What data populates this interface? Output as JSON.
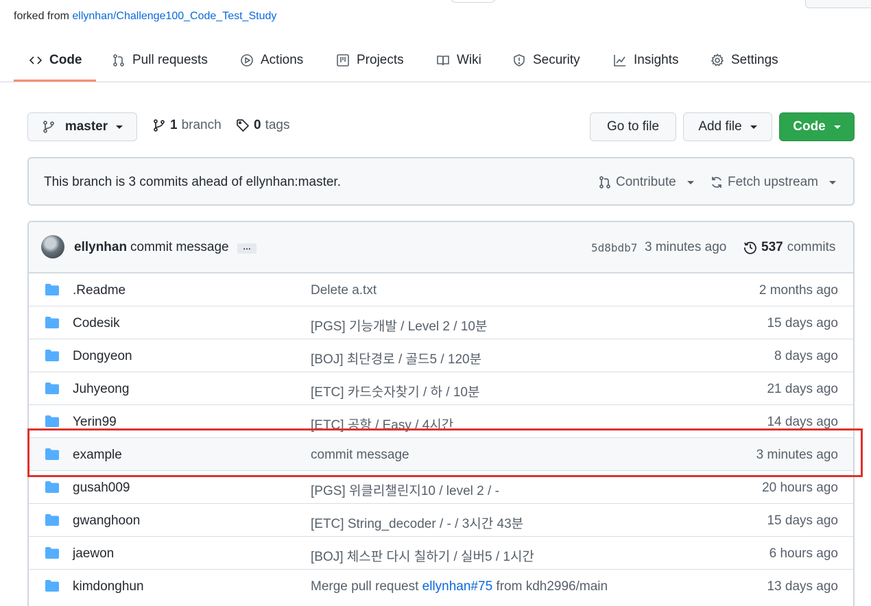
{
  "forked": {
    "prefix": "forked from ",
    "link": "ellynhan/Challenge100_Code_Test_Study"
  },
  "tabs": [
    {
      "label": "Code"
    },
    {
      "label": "Pull requests"
    },
    {
      "label": "Actions"
    },
    {
      "label": "Projects"
    },
    {
      "label": "Wiki"
    },
    {
      "label": "Security"
    },
    {
      "label": "Insights"
    },
    {
      "label": "Settings"
    }
  ],
  "branch_bar": {
    "branch_name": "master",
    "branch_count": "1",
    "branch_label": "branch",
    "tag_count": "0",
    "tag_label": "tags",
    "go_to_file": "Go to file",
    "add_file": "Add file",
    "code": "Code"
  },
  "ahead": {
    "message": "This branch is 3 commits ahead of ellynhan:master.",
    "contribute": "Contribute",
    "fetch_upstream": "Fetch upstream"
  },
  "latest_commit": {
    "author": "ellynhan",
    "message": "commit message",
    "ellipsis": "…",
    "sha": "5d8bdb7",
    "time": "3 minutes ago",
    "commit_count": "537",
    "commit_label": "commits"
  },
  "files": [
    {
      "name": ".Readme",
      "message": "Delete a.txt",
      "age": "2 months ago"
    },
    {
      "name": "Codesik",
      "message": "[PGS] 기능개발 / Level 2 / 10분",
      "age": "15 days ago"
    },
    {
      "name": "Dongyeon",
      "message": "[BOJ] 최단경로 / 골드5 / 120분",
      "age": "8 days ago"
    },
    {
      "name": "Juhyeong",
      "message": "[ETC] 카드숫자찾기 / 하 / 10분",
      "age": "21 days ago"
    },
    {
      "name": "Yerin99",
      "message": "[ETC] 공항 / Easy / 4시간",
      "age": "14 days ago"
    },
    {
      "name": "example",
      "message": "commit message",
      "age": "3 minutes ago"
    },
    {
      "name": "gusah009",
      "message": "[PGS] 위클리챌린지10 / level 2 / -",
      "age": "20 hours ago"
    },
    {
      "name": "gwanghoon",
      "message": "[ETC] String_decoder / - / 3시간 43분",
      "age": "15 days ago"
    },
    {
      "name": "jaewon",
      "message": "[BOJ] 체스판 다시 칠하기 / 실버5 / 1시간",
      "age": "6 hours ago"
    },
    {
      "name": "kimdonghun",
      "message_pre": "Merge pull request ",
      "message_link": "ellynhan#75",
      "message_post": " from kdh2996/main",
      "age": "13 days ago"
    }
  ],
  "colors": {
    "folder": "#54aeff",
    "link": "#0969da",
    "green_button": "#2da44e",
    "tab_underline": "#fd8c73",
    "annotation_box": "#e0312d"
  }
}
